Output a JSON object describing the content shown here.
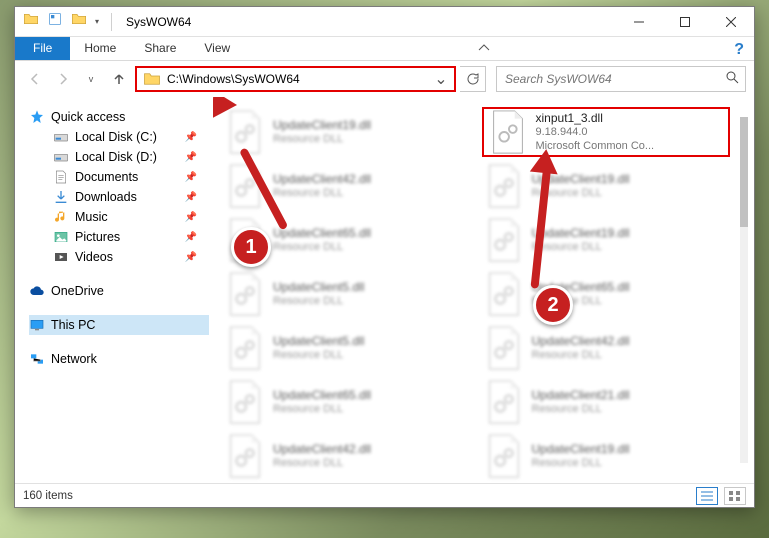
{
  "window": {
    "title": "SysWOW64",
    "item_count": "160 items"
  },
  "ribbon": {
    "file": "File",
    "home": "Home",
    "share": "Share",
    "view": "View"
  },
  "nav": {
    "address_path": "C:\\Windows\\SysWOW64",
    "search_placeholder": "Search SysWOW64"
  },
  "tree": {
    "quick_access": "Quick access",
    "local_c": "Local Disk (C:)",
    "local_d": "Local Disk (D:)",
    "documents": "Documents",
    "downloads": "Downloads",
    "music": "Music",
    "pictures": "Pictures",
    "videos": "Videos",
    "onedrive": "OneDrive",
    "this_pc": "This PC",
    "network": "Network"
  },
  "highlight": {
    "name": "xinput1_3.dll",
    "version": "9.18.944.0",
    "desc": "Microsoft Common Co..."
  },
  "blur_items": [
    {
      "n": "UpdateClient19.dll",
      "s": "Resource DLL"
    },
    {
      "n": "UpdateClient42.dll",
      "s": "Resource DLL"
    },
    {
      "n": "UpdateClient19.dll",
      "s": "Resource DLL"
    },
    {
      "n": "UpdateClient65.dll",
      "s": "Resource DLL"
    },
    {
      "n": "UpdateClient19.dll",
      "s": "Resource DLL"
    },
    {
      "n": "UpdateClient5.dll",
      "s": "Resource DLL"
    },
    {
      "n": "UpdateClient65.dll",
      "s": "Resource DLL"
    },
    {
      "n": "UpdateClient5.dll",
      "s": "Resource DLL"
    },
    {
      "n": "UpdateClient42.dll",
      "s": "Resource DLL"
    },
    {
      "n": "UpdateClient65.dll",
      "s": "Resource DLL"
    },
    {
      "n": "UpdateClient21.dll",
      "s": "Resource DLL"
    }
  ],
  "annotations": {
    "step1": "1",
    "step2": "2"
  }
}
